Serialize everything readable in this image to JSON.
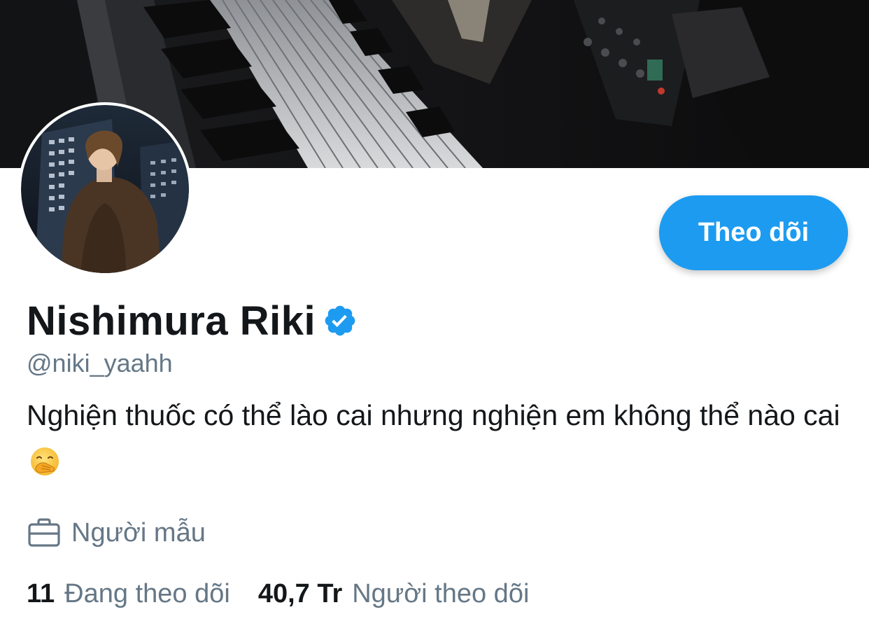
{
  "profile": {
    "display_name": "Nishimura Riki",
    "handle": "@niki_yaahh",
    "bio": "Nghiện thuốc có thể lào cai nhưng nghiện em không thể nào cai",
    "bio_emoji_icon": "face-with-hand-over-mouth-icon",
    "profession": "Người mẫu",
    "verified": true
  },
  "actions": {
    "follow_label": "Theo dõi"
  },
  "stats": {
    "following_count": "11",
    "following_label": "Đang theo dõi",
    "followers_count": "40,7 Tr",
    "followers_label": "Người theo dõi"
  },
  "colors": {
    "accent": "#1d9bf0",
    "text_primary": "#14171a",
    "text_secondary": "#657786",
    "background": "#ffffff"
  },
  "icons": {
    "verified": "verified-badge-icon",
    "profession": "briefcase-icon"
  }
}
